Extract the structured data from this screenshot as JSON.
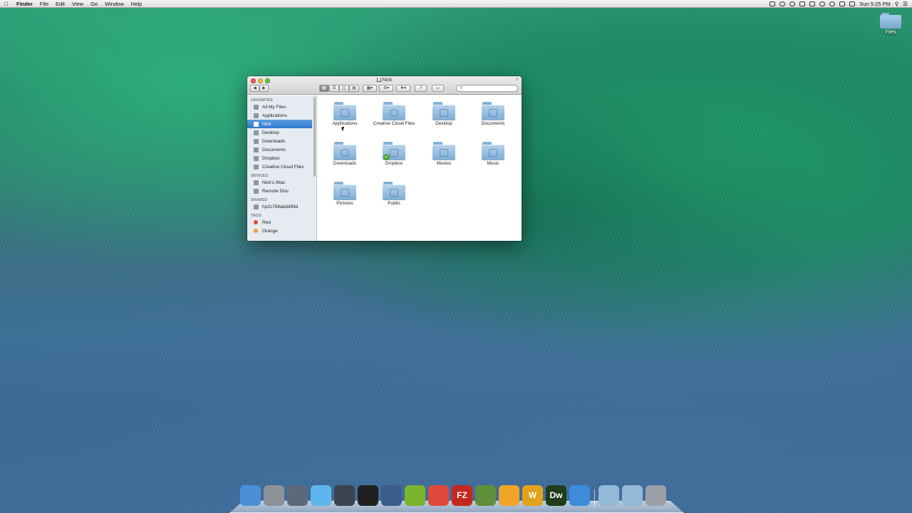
{
  "menubar": {
    "apple": "",
    "items": [
      "Finder",
      "File",
      "Edit",
      "View",
      "Go",
      "Window",
      "Help"
    ],
    "clock": "Sun 5:25 PM"
  },
  "desktop": {
    "icons": [
      {
        "label": "Files",
        "icon": "folder-icon"
      }
    ]
  },
  "window": {
    "title": "Nick",
    "search_placeholder": "",
    "sidebar": {
      "favorites_header": "FAVORITES",
      "favorites": [
        {
          "label": "All My Files",
          "icon": "all-files-icon"
        },
        {
          "label": "Applications",
          "icon": "applications-icon"
        },
        {
          "label": "Nick",
          "icon": "home-icon",
          "selected": true
        },
        {
          "label": "Desktop",
          "icon": "desktop-icon"
        },
        {
          "label": "Downloads",
          "icon": "downloads-icon"
        },
        {
          "label": "Documents",
          "icon": "documents-icon"
        },
        {
          "label": "Dropbox",
          "icon": "dropbox-icon"
        },
        {
          "label": "Creative Cloud Files",
          "icon": "creative-cloud-icon"
        }
      ],
      "devices_header": "DEVICES",
      "devices": [
        {
          "label": "Nick's iMac",
          "icon": "imac-icon"
        },
        {
          "label": "Remote Disc",
          "icon": "disc-icon"
        }
      ],
      "shared_header": "SHARED",
      "shared": [
        {
          "label": "hp2c768abdd99d",
          "icon": "shared-computer-icon"
        }
      ],
      "tags_header": "TAGS",
      "tags": [
        {
          "label": "Red",
          "color": "#e6463f"
        },
        {
          "label": "Orange",
          "color": "#f29b2f"
        }
      ]
    },
    "folders": [
      {
        "label": "Applications",
        "icon": "applications-folder-icon"
      },
      {
        "label": "Creative Cloud Files",
        "icon": "creative-cloud-folder-icon"
      },
      {
        "label": "Desktop",
        "icon": "desktop-folder-icon"
      },
      {
        "label": "Documents",
        "icon": "documents-folder-icon"
      },
      {
        "label": "Downloads",
        "icon": "downloads-folder-icon"
      },
      {
        "label": "Dropbox",
        "icon": "dropbox-folder-icon",
        "synced": true
      },
      {
        "label": "Movies",
        "icon": "movies-folder-icon"
      },
      {
        "label": "Music",
        "icon": "music-folder-icon"
      },
      {
        "label": "Pictures",
        "icon": "pictures-folder-icon"
      },
      {
        "label": "Public",
        "icon": "public-folder-icon"
      }
    ]
  },
  "dock": {
    "apps": [
      {
        "name": "finder-icon",
        "color": "#4a8fd8",
        "glyph": ""
      },
      {
        "name": "system-preferences-icon",
        "color": "#8d9299",
        "glyph": ""
      },
      {
        "name": "launchpad-icon",
        "color": "#5b6a7b",
        "glyph": ""
      },
      {
        "name": "messages-icon",
        "color": "#5fb6ee",
        "glyph": ""
      },
      {
        "name": "pixelmator-icon",
        "color": "#3b4350",
        "glyph": ""
      },
      {
        "name": "photo-booth-icon",
        "color": "#202020",
        "glyph": ""
      },
      {
        "name": "imovie-icon",
        "color": "#3a5d8a",
        "glyph": ""
      },
      {
        "name": "spotify-icon",
        "color": "#7bb52d",
        "glyph": ""
      },
      {
        "name": "chrome-icon",
        "color": "#e04a3a",
        "glyph": ""
      },
      {
        "name": "filezilla-icon",
        "color": "#c5271e",
        "glyph": "FZ"
      },
      {
        "name": "minecraft-icon",
        "color": "#5f8f3a",
        "glyph": ""
      },
      {
        "name": "chrome-canary-icon",
        "color": "#f0a428",
        "glyph": ""
      },
      {
        "name": "wunderlist-icon",
        "color": "#e3a21b",
        "glyph": "W"
      },
      {
        "name": "dreamweaver-icon",
        "color": "#1f3d1a",
        "glyph": "Dw"
      },
      {
        "name": "dropbox-icon",
        "color": "#3d8ddb",
        "glyph": ""
      },
      {
        "name": "applications-stack-icon",
        "color": "#93b8d8",
        "glyph": ""
      },
      {
        "name": "downloads-stack-icon",
        "color": "#93b8d8",
        "glyph": ""
      },
      {
        "name": "trash-icon",
        "color": "#9aa0a6",
        "glyph": ""
      }
    ]
  }
}
